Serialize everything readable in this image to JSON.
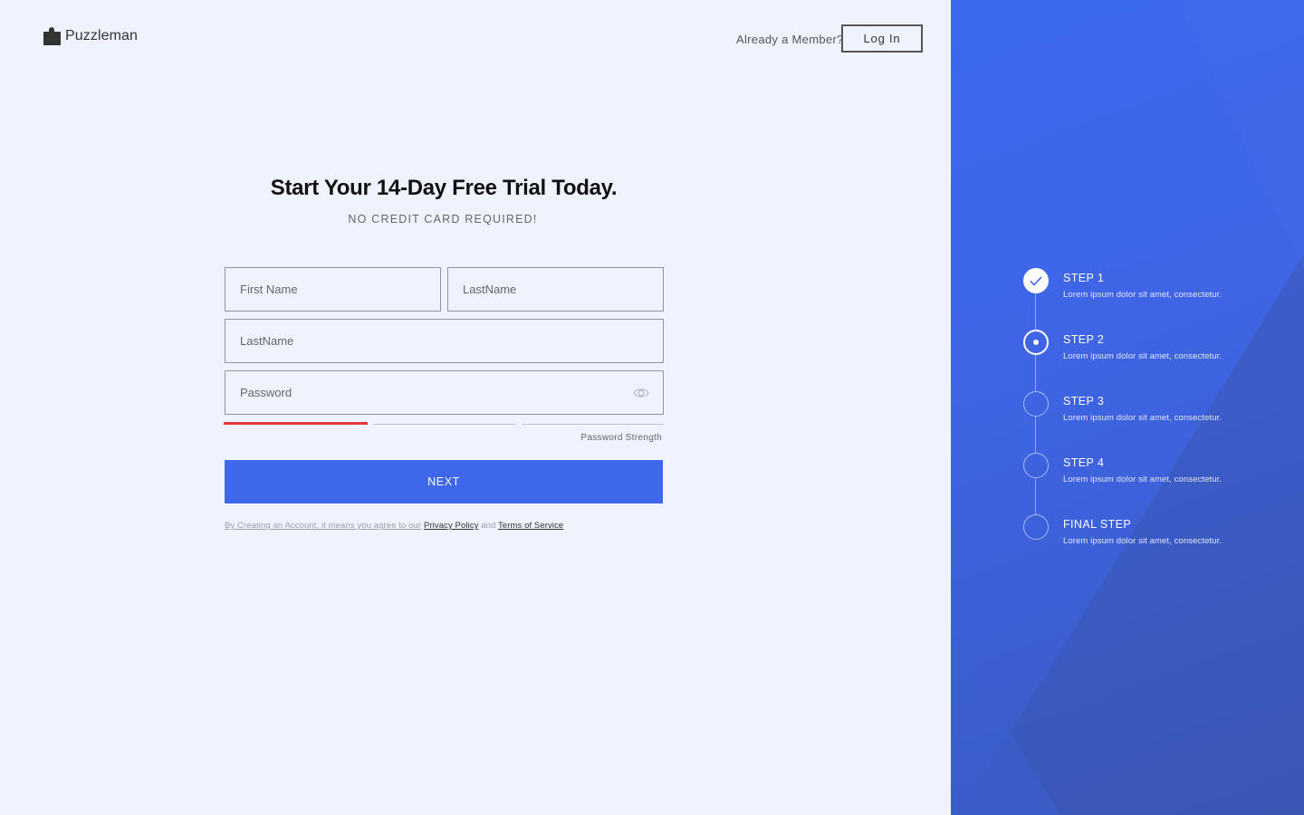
{
  "brand": {
    "name": "Puzzleman",
    "logo_icon": "puzzle-piece-icon"
  },
  "header": {
    "member_prompt": "Already a Member?",
    "login_label": "Log In"
  },
  "hero": {
    "title": "Start Your 14-Day Free Trial Today.",
    "subtitle": "NO CREDIT CARD REQUIRED!"
  },
  "form": {
    "first_name_placeholder": "First Name",
    "last_name_placeholder": "LastName",
    "email_placeholder": "LastName",
    "password_placeholder": "Password",
    "password_strength_label": "Password Strength",
    "password_strength_level": 1,
    "password_strength_total": 3,
    "next_label": "NEXT"
  },
  "terms": {
    "prefix": "By Creating an Account, it means you agree to our",
    "privacy_link": "Privacy Policy",
    "and": "and",
    "terms_link": "Terms of Service"
  },
  "steps": [
    {
      "title": "STEP 1",
      "desc": "Lorem ipsum dolor sit amet, consectetur.",
      "state": "done"
    },
    {
      "title": "STEP 2",
      "desc": "Lorem ipsum dolor sit amet, consectetur.",
      "state": "active"
    },
    {
      "title": "STEP 3",
      "desc": "Lorem ipsum dolor sit amet, consectetur.",
      "state": "pending"
    },
    {
      "title": "STEP 4",
      "desc": "Lorem ipsum dolor sit amet, consectetur.",
      "state": "pending"
    },
    {
      "title": "FINAL STEP",
      "desc": "Lorem ipsum dolor sit amet, consectetur.",
      "state": "pending"
    }
  ],
  "colors": {
    "accent": "#3f67ec",
    "strength_weak": "#e23a3a",
    "panel": "#3c68f0",
    "background": "#eff3fe"
  }
}
